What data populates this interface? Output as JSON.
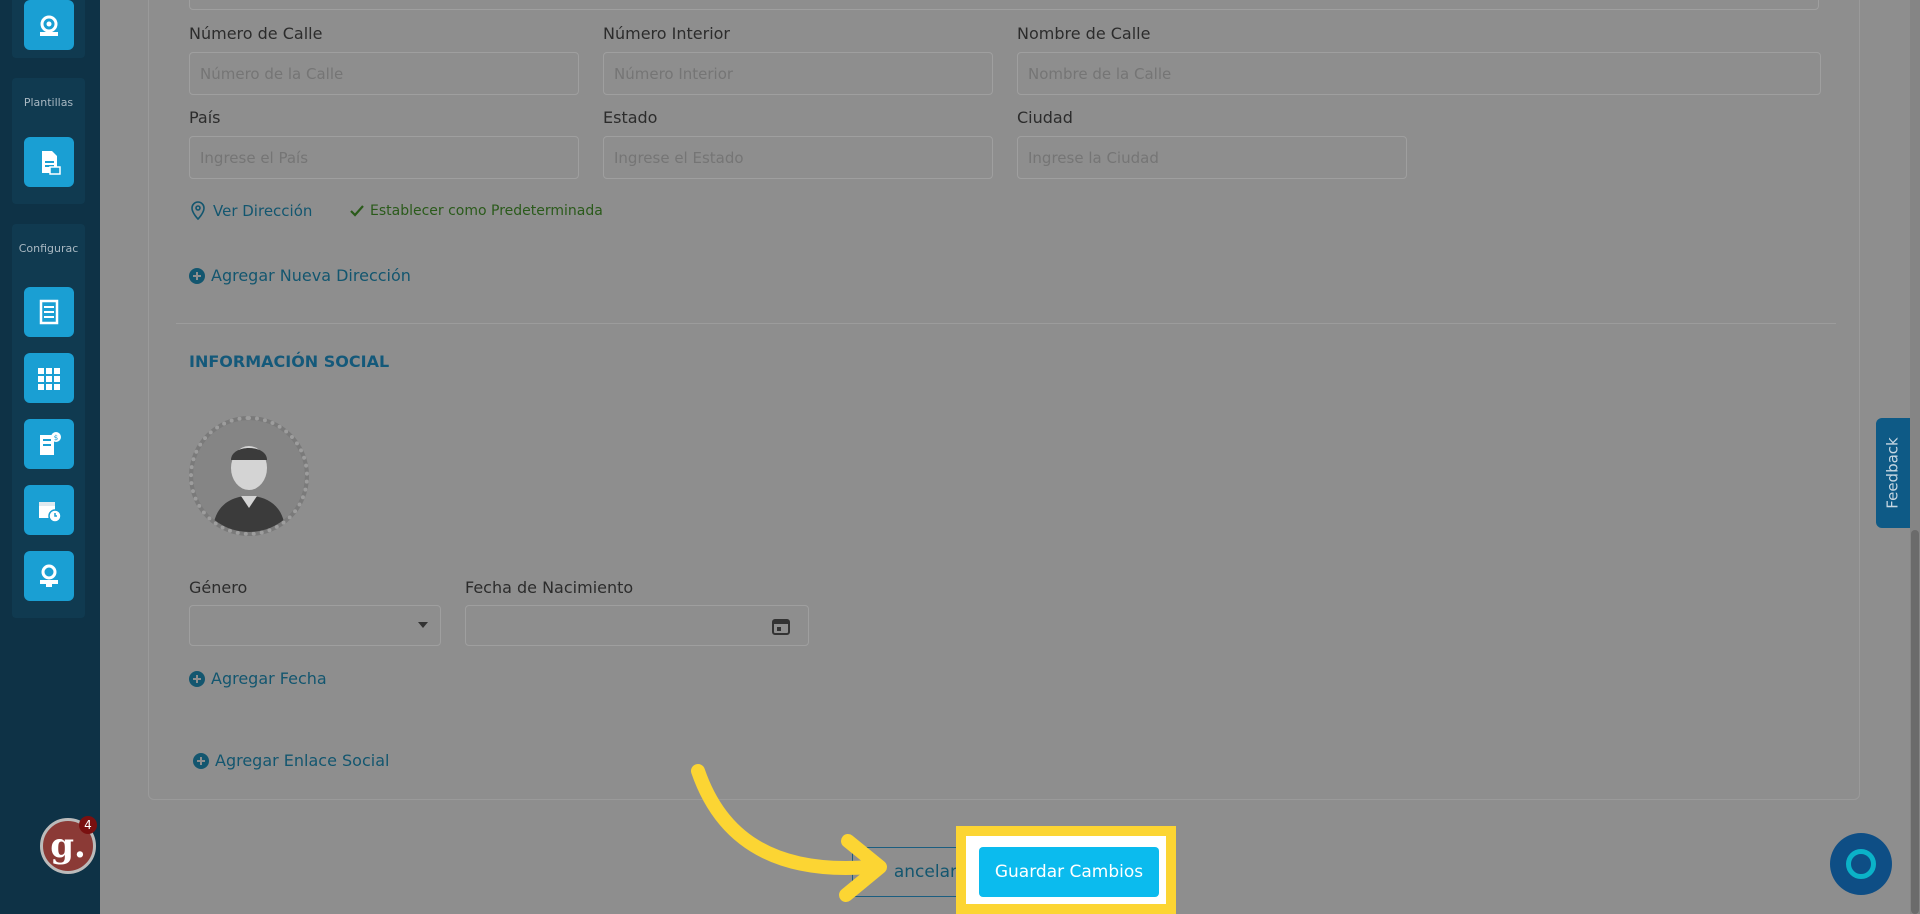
{
  "sidebar": {
    "plantillas_label": "Plantillas",
    "configuracion_label": "Configurac"
  },
  "address": {
    "street_number_label": "Número de Calle",
    "street_number_placeholder": "Número de la Calle",
    "interior_number_label": "Número Interior",
    "interior_number_placeholder": "Número Interior",
    "street_name_label": "Nombre de Calle",
    "street_name_placeholder": "Nombre de la Calle",
    "country_label": "País",
    "country_placeholder": "Ingrese el País",
    "state_label": "Estado",
    "state_placeholder": "Ingrese el Estado",
    "city_label": "Ciudad",
    "city_placeholder": "Ingrese la Ciudad",
    "view_address": "Ver Dirección",
    "set_default": "Establecer como Predeterminada",
    "add_address": "Agregar Nueva Dirección"
  },
  "social": {
    "title": "INFORMACIÓN SOCIAL",
    "gender_label": "Género",
    "birthdate_label": "Fecha de Nacimiento",
    "add_date": "Agregar Fecha",
    "add_social_link": "Agregar Enlace Social"
  },
  "footer": {
    "cancel_label": "Cancelar",
    "save_label": "Guardar Cambios"
  },
  "widgets": {
    "feedback_label": "Feedback",
    "g_badge_letter": "g.",
    "g_badge_count": "4"
  },
  "colors": {
    "accent": "#0bbbee",
    "highlight": "#fcd533",
    "sidebar": "#0e3246"
  }
}
